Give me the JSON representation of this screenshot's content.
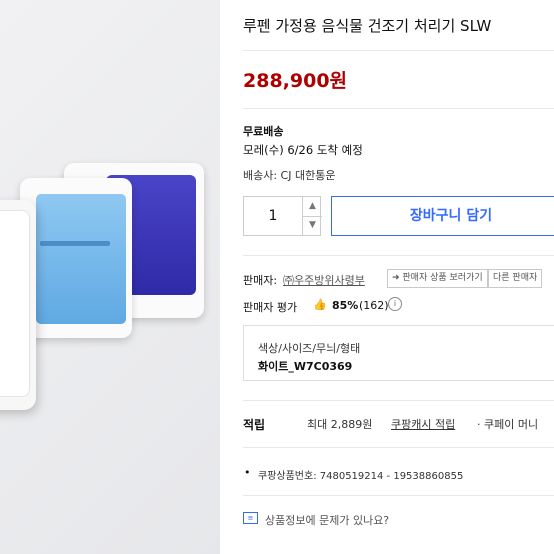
{
  "product": {
    "title": "루펜 가정용 음식물 건조기 처리기 SLW",
    "price": "288,900원"
  },
  "shipping": {
    "free_label": "무료배송",
    "eta": "모레(수) 6/26 도착 예정",
    "carrier": "배송사: CJ 대한통운"
  },
  "purchase": {
    "quantity": "1",
    "cart_button": "장바구니 담기"
  },
  "seller": {
    "label": "판매자:",
    "name": "㈜우주방위사령부",
    "view_products": "판매자 상품 보러가기",
    "other_sellers": "다른 판매자",
    "rating_label": "판매자 평가",
    "rating_percent": "85%",
    "rating_count": "(162)"
  },
  "options": {
    "header": "색상/사이즈/무늬/형태",
    "selected": "화이트_W7C0369"
  },
  "points": {
    "label": "적립",
    "max_text": "최대 2,889원",
    "coupang_cash_link": "쿠팡캐시 적립",
    "coupay_text": "· 쿠페이 머니"
  },
  "meta": {
    "product_number": "쿠팡상품번호: 7480519214 - 19538860855",
    "report_text": "상품정보에 문제가 있나요?"
  },
  "colors": {
    "price_red": "#ae0000",
    "accent_blue": "#346aff"
  }
}
